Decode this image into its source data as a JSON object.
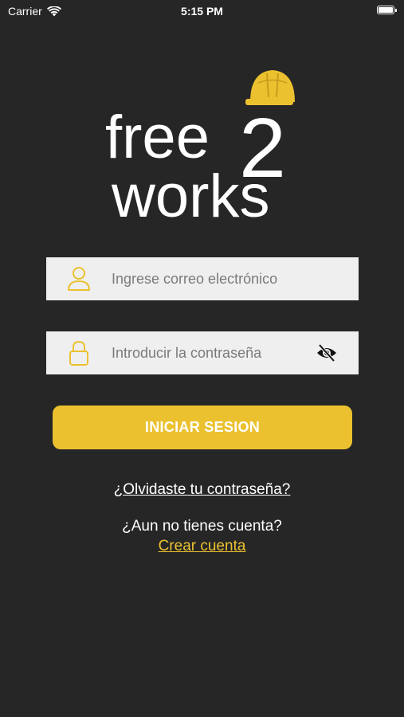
{
  "status_bar": {
    "carrier": "Carrier",
    "time": "5:15 PM",
    "battery_level": 1.0
  },
  "logo": {
    "line1": "free",
    "digit": "2",
    "line2": "works",
    "accent_color": "#ebc12f"
  },
  "email_field": {
    "placeholder": "Ingrese correo electrónico",
    "value": "",
    "icon": "user-icon"
  },
  "password_field": {
    "placeholder": "Introducir la contraseña",
    "value": "",
    "icon": "lock-icon",
    "toggle_icon": "eye-off-icon"
  },
  "login_button": {
    "label": "INICIAR SESION"
  },
  "links": {
    "forgot_password": "¿Olvidaste tu contraseña?",
    "no_account": "¿Aun no tienes cuenta?",
    "create_account": "Crear cuenta"
  },
  "colors": {
    "background": "#262626",
    "accent": "#ebc12f",
    "field_background": "#efefef"
  }
}
